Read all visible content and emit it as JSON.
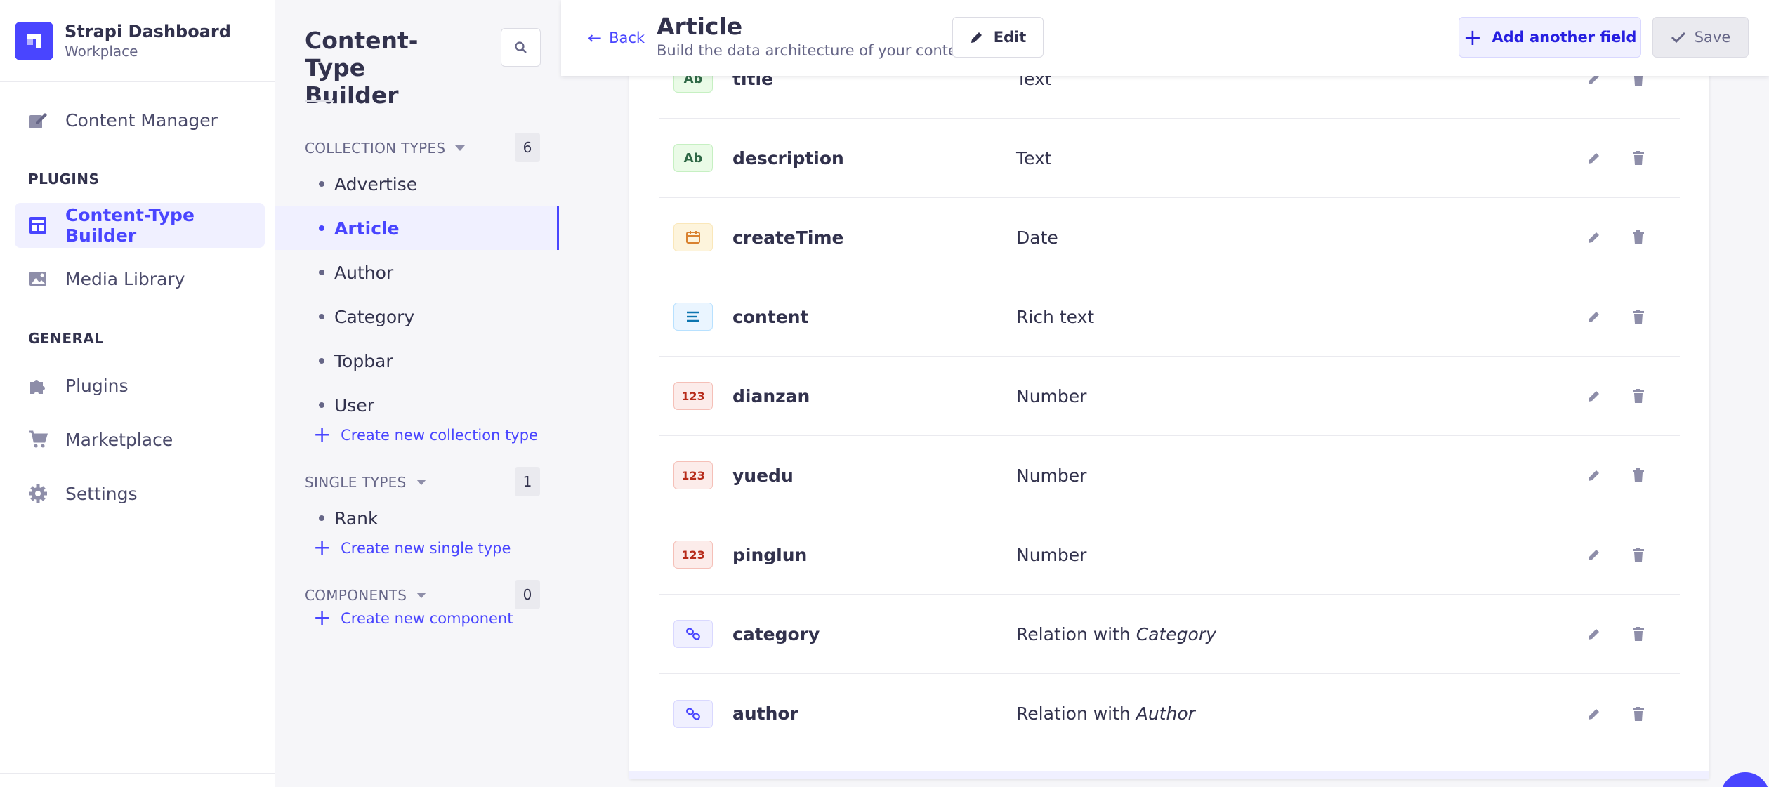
{
  "brand": {
    "title": "Strapi Dashboard",
    "subtitle": "Workplace"
  },
  "nav": {
    "content_manager": "Content Manager",
    "plugins_heading": "PLUGINS",
    "ctb": "Content-Type Builder",
    "media": "Media Library",
    "general_heading": "GENERAL",
    "plugins": "Plugins",
    "marketplace": "Marketplace",
    "settings": "Settings"
  },
  "subnav": {
    "title": "Content-Type Builder",
    "collection_heading": "COLLECTION TYPES",
    "collection_count": "6",
    "collection_items": [
      "Advertise",
      "Article",
      "Author",
      "Category",
      "Topbar",
      "User"
    ],
    "create_collection": "Create new collection type",
    "single_heading": "SINGLE TYPES",
    "single_count": "1",
    "single_items": [
      "Rank"
    ],
    "create_single": "Create new single type",
    "components_heading": "COMPONENTS",
    "components_count": "0",
    "create_component": "Create new component"
  },
  "header": {
    "back": "Back",
    "title": "Article",
    "subtitle": "Build the data architecture of your content",
    "edit": "Edit",
    "add_field": "Add another field",
    "save": "Save"
  },
  "fields": [
    {
      "icon": "text-icon",
      "badge": "Ab",
      "name": "title",
      "type": "Text",
      "relation": ""
    },
    {
      "icon": "text-icon",
      "badge": "Ab",
      "name": "description",
      "type": "Text",
      "relation": ""
    },
    {
      "icon": "calendar-icon",
      "badge": "",
      "name": "createTime",
      "type": "Date",
      "relation": ""
    },
    {
      "icon": "rich-text-icon",
      "badge": "",
      "name": "content",
      "type": "Rich text",
      "relation": ""
    },
    {
      "icon": "number-icon",
      "badge": "123",
      "name": "dianzan",
      "type": "Number",
      "relation": ""
    },
    {
      "icon": "number-icon",
      "badge": "123",
      "name": "yuedu",
      "type": "Number",
      "relation": ""
    },
    {
      "icon": "number-icon",
      "badge": "123",
      "name": "pinglun",
      "type": "Number",
      "relation": ""
    },
    {
      "icon": "link-icon",
      "badge": "",
      "name": "category",
      "type": "Relation with ",
      "relation": "Category"
    },
    {
      "icon": "link-icon",
      "badge": "",
      "name": "author",
      "type": "Relation with ",
      "relation": "Author"
    }
  ],
  "colors": {
    "accent": "#4945ff",
    "accent_light": "#f0f0ff"
  }
}
